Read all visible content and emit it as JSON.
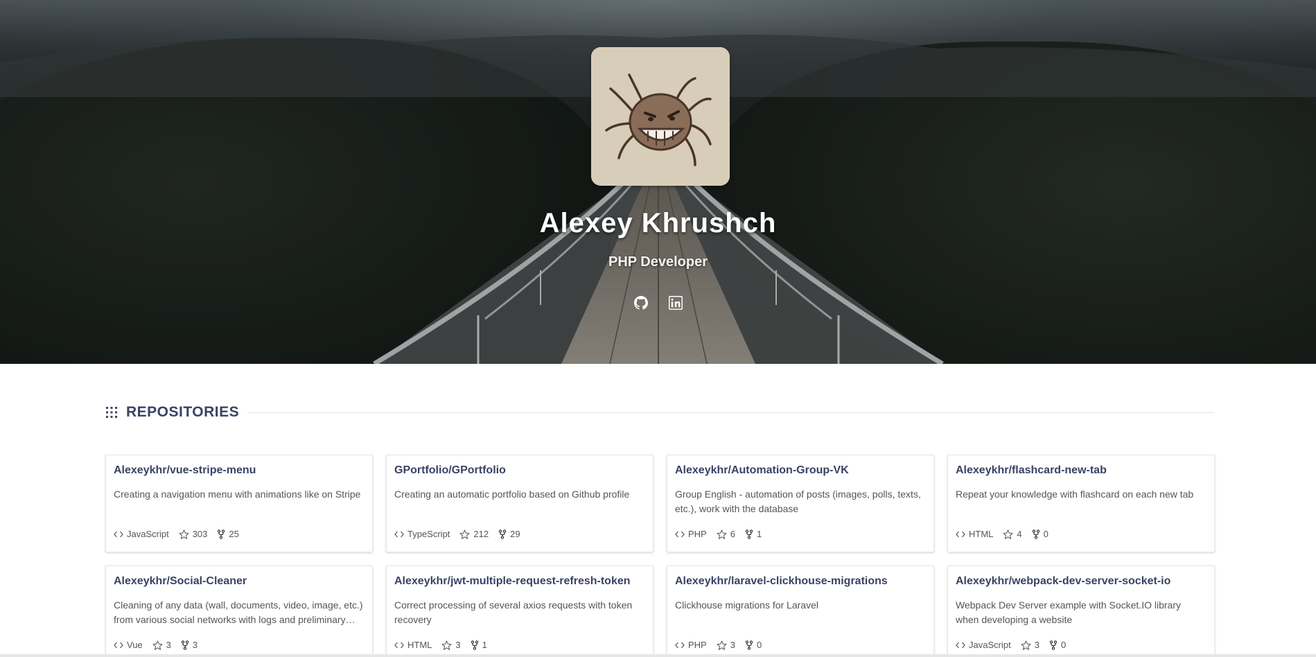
{
  "profile": {
    "name": "Alexey Khrushch",
    "role": "PHP Developer",
    "socials": [
      "github-icon",
      "linkedin-icon"
    ]
  },
  "section": {
    "title": "REPOSITORIES",
    "icon": "grid-dots-icon"
  },
  "colors": {
    "accent": "#3b4265",
    "text": "#555555",
    "card_border": "#e7e7ea"
  },
  "repos": [
    {
      "title": "Alexeykhr/vue-stripe-menu",
      "desc": "Creating a navigation menu with animations like on Stripe",
      "lang": "JavaScript",
      "stars": "303",
      "forks": "25"
    },
    {
      "title": "GPortfolio/GPortfolio",
      "desc": "Creating an automatic portfolio based on Github profile",
      "lang": "TypeScript",
      "stars": "212",
      "forks": "29"
    },
    {
      "title": "Alexeykhr/Automation-Group-VK",
      "desc": "Group English - automation of posts (images, polls, texts, etc.), work with the database",
      "lang": "PHP",
      "stars": "6",
      "forks": "1"
    },
    {
      "title": "Alexeykhr/flashcard-new-tab",
      "desc": "Repeat your knowledge with flashcard on each new tab",
      "lang": "HTML",
      "stars": "4",
      "forks": "0"
    },
    {
      "title": "Alexeykhr/Social-Cleaner",
      "desc": "Cleaning of any data (wall, documents, video, image, etc.) from various social networks with logs and preliminary…",
      "lang": "Vue",
      "stars": "3",
      "forks": "3"
    },
    {
      "title": "Alexeykhr/jwt-multiple-request-refresh-token",
      "desc": "Correct processing of several axios requests with token recovery",
      "lang": "HTML",
      "stars": "3",
      "forks": "1"
    },
    {
      "title": "Alexeykhr/laravel-clickhouse-migrations",
      "desc": "Clickhouse migrations for Laravel",
      "lang": "PHP",
      "stars": "3",
      "forks": "0"
    },
    {
      "title": "Alexeykhr/webpack-dev-server-socket-io",
      "desc": "Webpack Dev Server example with Socket.IO library when developing a website",
      "lang": "JavaScript",
      "stars": "3",
      "forks": "0"
    }
  ]
}
